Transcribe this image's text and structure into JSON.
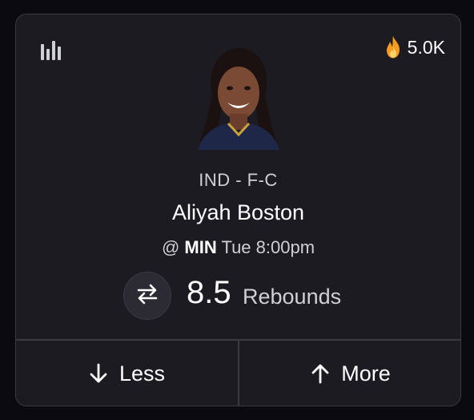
{
  "card": {
    "popularity": "5.0K",
    "position_line": "IND - F-C",
    "player_name": "Aliyah Boston",
    "game": {
      "prefix": "@",
      "opponent": "MIN",
      "time": "Tue 8:00pm"
    },
    "line_value": "8.5",
    "stat_label": "Rebounds",
    "actions": {
      "less_label": "Less",
      "more_label": "More"
    }
  },
  "colors": {
    "background": "#0b0a10",
    "card": "#1c1b22",
    "border": "#3a3942",
    "text_primary": "#ffffff",
    "text_secondary": "#cfcfd6",
    "flame": "#f5a623"
  },
  "icons": [
    "stats-bars-icon",
    "fire-icon",
    "swap-arrows-icon",
    "arrow-down-icon",
    "arrow-up-icon"
  ]
}
